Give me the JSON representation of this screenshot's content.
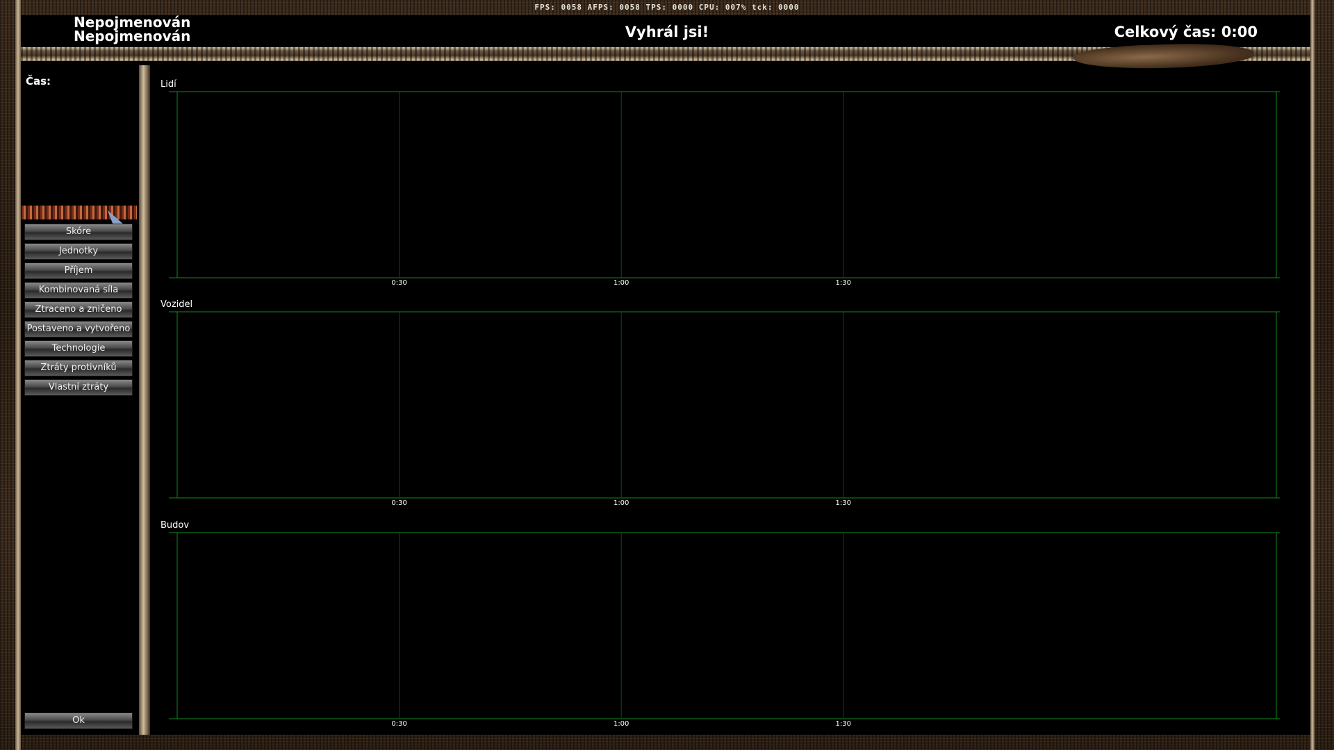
{
  "hud": {
    "fps_text": "FPS: 0058 AFPS: 0058 TPS: 0000 CPU: 007% tck: 0000"
  },
  "header": {
    "players": [
      "Nepojmenován",
      "Nepojmenován"
    ],
    "result": "Vyhrál jsi!",
    "total_time": "Celkový čas: 0:00"
  },
  "sidebar": {
    "time_label": "Čas:",
    "menu": [
      "Skóre",
      "Jednotky",
      "Příjem",
      "Kombinovaná síla",
      "Ztraceno a zničeno",
      "Postaveno a vytvořeno",
      "Technologie",
      "Ztráty protivníků",
      "Vlastní ztráty"
    ],
    "ok_label": "Ok"
  },
  "graphs": [
    {
      "title": "Lidí"
    },
    {
      "title": "Vozidel"
    },
    {
      "title": "Budov"
    }
  ],
  "chart_data": [
    {
      "type": "line",
      "title": "Lidí",
      "x_ticks": [
        "0:30",
        "1:00",
        "1:30"
      ],
      "series": [],
      "grid": true
    },
    {
      "type": "line",
      "title": "Vozidel",
      "x_ticks": [
        "0:30",
        "1:00",
        "1:30"
      ],
      "series": [],
      "grid": true
    },
    {
      "type": "line",
      "title": "Budov",
      "x_ticks": [
        "0:30",
        "1:00",
        "1:30"
      ],
      "series": [],
      "grid": true
    }
  ],
  "colors": {
    "grid": "#0f8a1a",
    "grid_dim": "#0b4a12",
    "tick_text": "#ffffff"
  },
  "icons": {
    "cursor": "pointer-arrow-icon"
  }
}
